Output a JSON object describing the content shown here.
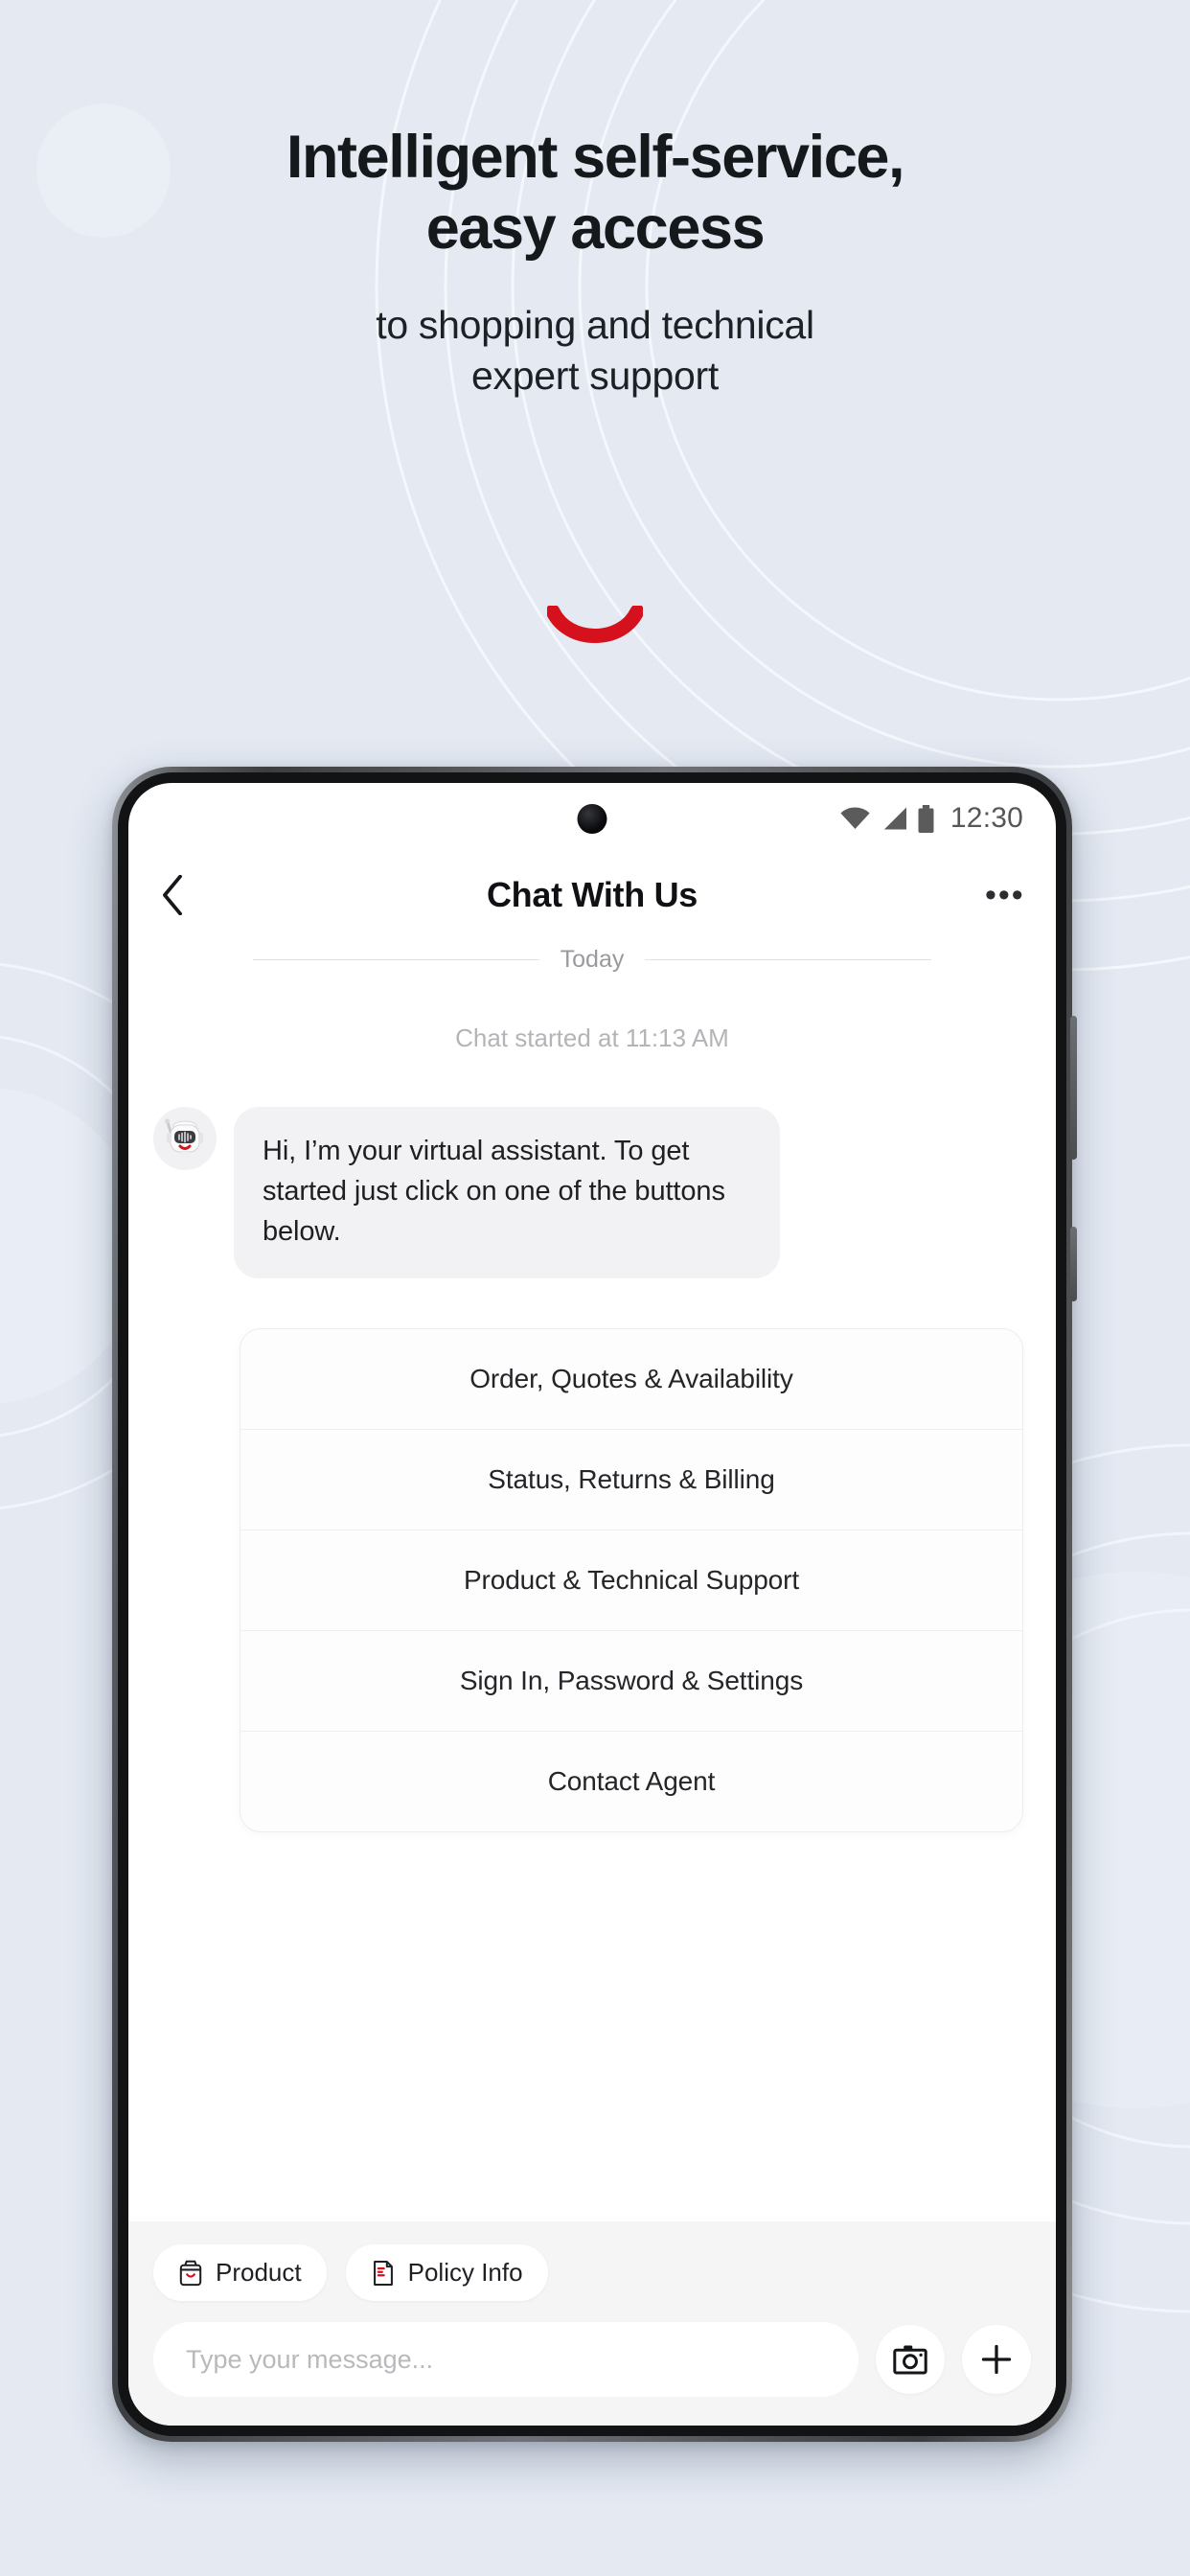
{
  "promo": {
    "headline_line1": "Intelligent self-service,",
    "headline_line2": "easy access",
    "subhead_line1": "to shopping and technical",
    "subhead_line2": "expert support",
    "accent_color": "#d4111d",
    "background_color": "#e4e9f2"
  },
  "phone": {
    "status_bar": {
      "time": "12:30",
      "wifi_icon": "wifi-icon",
      "signal_icon": "signal-icon",
      "battery_icon": "battery-icon"
    },
    "header": {
      "back_icon": "back-chevron-icon",
      "title": "Chat With Us",
      "menu_icon": "overflow-menu-icon",
      "menu_label": "•••"
    },
    "divider": {
      "today_label": "Today"
    },
    "chat_started": "Chat started at 11:13 AM",
    "messages": [
      {
        "sender": "bot",
        "avatar_icon": "robot-avatar-icon",
        "text": "Hi, I’m your virtual assistant. To get started just click on one of the buttons below."
      }
    ],
    "options": [
      "Order, Quotes & Availability",
      "Status, Returns & Billing",
      "Product & Technical Support",
      "Sign In, Password & Settings",
      "Contact Agent"
    ],
    "quick_chips": [
      {
        "label": "Product",
        "icon": "shopping-bag-icon"
      },
      {
        "label": "Policy Info",
        "icon": "document-icon"
      }
    ],
    "composer": {
      "placeholder": "Type your message...",
      "value": "",
      "camera_icon": "camera-icon",
      "add_icon": "plus-icon"
    }
  }
}
